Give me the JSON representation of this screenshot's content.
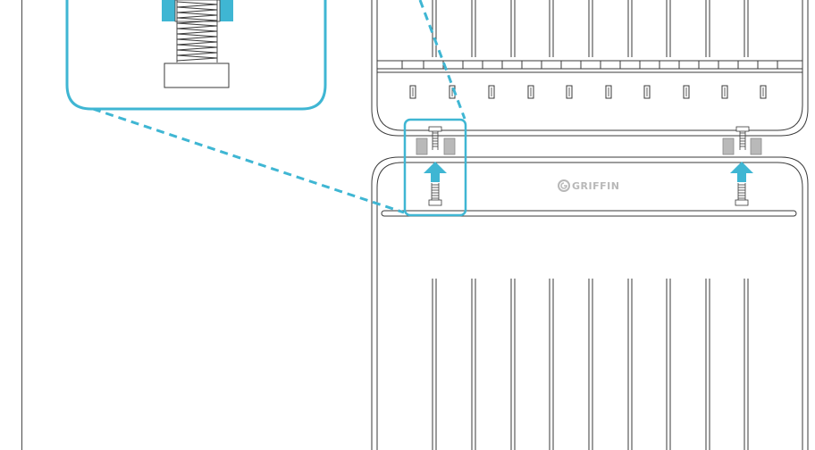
{
  "brand": {
    "name": "GRIFFIN"
  },
  "colors": {
    "accent": "#3FB6D3",
    "line": "#3a3a3a",
    "stroke_light": "#8a8a8a",
    "pad_gray": "#b9b9b9",
    "background": "#ffffff"
  },
  "icons": {
    "logo": "griffin-logo-icon",
    "arrow": "arrow-up-icon",
    "screw": "screw-icon"
  }
}
